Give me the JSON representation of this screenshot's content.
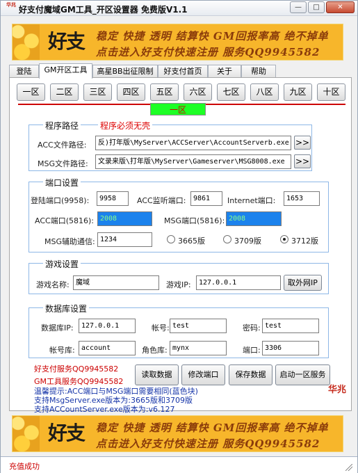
{
  "window": {
    "title": "好支付魔域GM工具_开区设置器 免费版V1.1",
    "icon_text": "华兆",
    "buttons": {
      "minimize": "—",
      "maximize": "□",
      "close": "✕"
    }
  },
  "banner": {
    "logo": "好支付",
    "line1": "稳定 快捷 透明 结算快 GM回报率高 绝不掉单",
    "line2": "点击进入好支付快速注册 服务QQ9945582"
  },
  "tabs": [
    "登陆",
    "GM开区工具",
    "高星BB出征限制",
    "好支付首页",
    "关于",
    "帮助"
  ],
  "zones": [
    "一区",
    "二区",
    "三区",
    "四区",
    "五区",
    "六区",
    "七区",
    "八区",
    "九区",
    "十区"
  ],
  "current_zone": "一区",
  "program_path": {
    "title": "程序路径",
    "warning": "程序必须无壳",
    "acc_label": "ACC文件路径:",
    "acc_value": "反)打年版\\MyServer\\ACCServer\\AccountServerb.exe",
    "msg_label": "MSG文件路径:",
    "msg_value": "文录来版\\打年版\\MyServer\\Gameserver\\MSG8008.exe",
    "browse": ">>"
  },
  "ports": {
    "title": "端口设置",
    "login_label": "登陆端口(9958):",
    "login_value": "9958",
    "acc_listen_label": "ACC监听端口:",
    "acc_listen_value": "9861",
    "internet_label": "Internet端口:",
    "internet_value": "1653",
    "acc_label": "ACC端口(5816):",
    "acc_value": "2008",
    "msg_label": "MSG端口(5816):",
    "msg_value": "2008",
    "assist_label": "MSG辅助通信:",
    "assist_value": "1234",
    "versions": [
      "3665版",
      "3709版",
      "3712版"
    ],
    "selected_version": "3712版"
  },
  "game": {
    "title": "游戏设置",
    "name_label": "游戏名称:",
    "name_value": "魔域",
    "ip_label": "游戏IP:",
    "ip_value": "127.0.0.1",
    "external_ip_button": "取外网IP"
  },
  "database": {
    "title": "数据库设置",
    "ip_label": "数据库IP:",
    "ip_value": "127.0.0.1",
    "account_label": "帐号:",
    "account_value": "test",
    "password_label": "密码:",
    "password_value": "test",
    "accountdb_label": "帐号库:",
    "accountdb_value": "account",
    "roledb_label": "角色库:",
    "roledb_value": "mynx",
    "port_label": "端口:",
    "port_value": "3306"
  },
  "services": {
    "qq1": "好支付服务QQ9945582",
    "qq2": "GM工具服务QQ9945582"
  },
  "actions": {
    "read": "读取数据",
    "modify_port": "修改端口",
    "save": "保存数据",
    "start": "启动一区服务"
  },
  "tips": [
    "温馨提示:ACC端口与MSG端口需要相同(蓝色块)",
    "支持MsgServer.exe版本为:3665版和3709版",
    "支持ACCountServer.exe版本为:v6.127"
  ],
  "brand": "华兆",
  "status": "充值成功",
  "colors": {
    "accent": "#1dff25",
    "warning": "#cc0000",
    "selected_field": "#1c82ec",
    "banner": "#f7b62b"
  }
}
